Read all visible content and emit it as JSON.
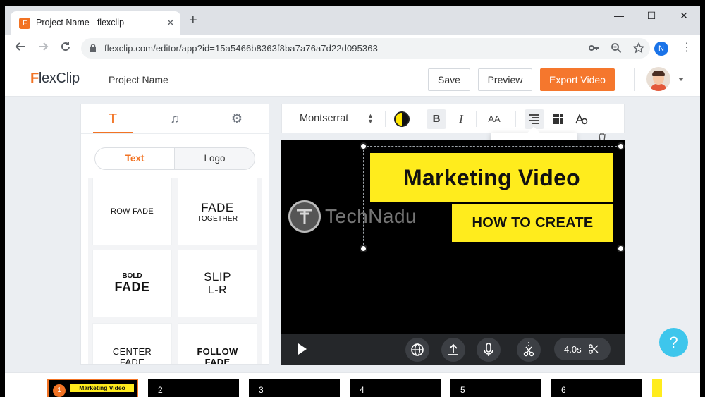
{
  "browser": {
    "tab_title": "Project Name - flexclip",
    "tab_favicon": "F",
    "tab_close": "✕",
    "new_tab": "+",
    "url": "flexclip.com/editor/app?id=15a5466b8363f8ba7a76a7d22d095363",
    "profile_initial": "N",
    "window_minimize": "—",
    "window_maximize": "☐",
    "window_close": "✕"
  },
  "header": {
    "logo": "FlexClip",
    "logo_f": "F",
    "logo_rest": "lexClip",
    "project_name": "Project Name",
    "save_label": "Save",
    "preview_label": "Preview",
    "export_label": "Export Video"
  },
  "left_panel": {
    "tabs": [
      {
        "icon": "text-icon",
        "glyph": "T"
      },
      {
        "icon": "music-icon",
        "glyph": "♫"
      },
      {
        "icon": "gear-icon",
        "glyph": "⚙"
      }
    ],
    "segments": [
      "Text",
      "Logo"
    ],
    "cards": [
      {
        "line1": "ROW FADE",
        "line2": ""
      },
      {
        "line1": "FADE",
        "line2": "TOGETHER"
      },
      {
        "line1": "BOLD",
        "line2": "FADE"
      },
      {
        "line1": "SLIP",
        "line2": "L-R"
      },
      {
        "line1": "CENTER",
        "line2": "FADE"
      },
      {
        "line1": "FOLLOW",
        "line2": "FADE"
      }
    ]
  },
  "text_toolbar": {
    "font": "Montserrat",
    "font_arrows": "▲▼",
    "color_swatch": "yellow-black",
    "bold": "B",
    "italic": "I",
    "size": "AA"
  },
  "canvas": {
    "title_text": "Marketing Video",
    "subtitle_text": "HOW TO CREATE",
    "watermark": "TechNadu",
    "watermark_logo": "T",
    "duration": "4.0s",
    "accent": "#ffec1d"
  },
  "help": {
    "label": "?"
  },
  "timeline": {
    "scenes": [
      {
        "num": "1",
        "thumb": "Marketing Video"
      },
      {
        "num": "2"
      },
      {
        "num": "3"
      },
      {
        "num": "4"
      },
      {
        "num": "5"
      },
      {
        "num": "6"
      }
    ]
  },
  "colors": {
    "brand_orange": "#f27324",
    "export_button": "#f5772d",
    "help_button": "#3ec6ec",
    "banner_yellow": "#ffec1d"
  }
}
